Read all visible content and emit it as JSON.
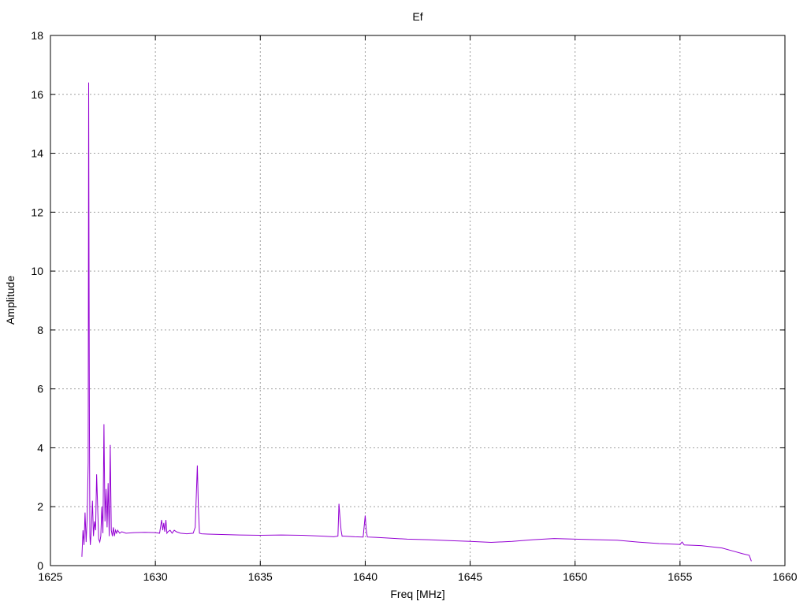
{
  "chart_data": {
    "type": "line",
    "title": "Ef",
    "xlabel": "Freq [MHz]",
    "ylabel": "Amplitude",
    "xlim": [
      1625,
      1660
    ],
    "ylim": [
      0,
      18
    ],
    "xticks": [
      1625,
      1630,
      1635,
      1640,
      1645,
      1650,
      1655,
      1660
    ],
    "yticks": [
      0,
      2,
      4,
      6,
      8,
      10,
      12,
      14,
      16,
      18
    ],
    "grid": true,
    "legend": "none",
    "series": [
      {
        "color": "#9400d3",
        "x": [
          1626.5,
          1626.55,
          1626.6,
          1626.65,
          1626.7,
          1626.75,
          1626.8,
          1626.82,
          1626.84,
          1626.86,
          1626.88,
          1626.9,
          1626.95,
          1627.0,
          1627.05,
          1627.1,
          1627.15,
          1627.2,
          1627.3,
          1627.35,
          1627.4,
          1627.45,
          1627.5,
          1627.55,
          1627.6,
          1627.65,
          1627.7,
          1627.75,
          1627.8,
          1627.85,
          1627.9,
          1627.95,
          1628.0,
          1628.05,
          1628.1,
          1628.15,
          1628.2,
          1628.3,
          1628.4,
          1628.6,
          1629.0,
          1629.5,
          1630.0,
          1630.2,
          1630.3,
          1630.35,
          1630.4,
          1630.45,
          1630.5,
          1630.55,
          1630.6,
          1630.7,
          1630.8,
          1630.9,
          1631.0,
          1631.2,
          1631.5,
          1631.8,
          1631.9,
          1632.0,
          1632.05,
          1632.1,
          1632.2,
          1632.5,
          1633.0,
          1634.0,
          1635.0,
          1636.0,
          1637.0,
          1638.0,
          1638.5,
          1638.7,
          1638.75,
          1638.8,
          1638.85,
          1638.9,
          1639.0,
          1639.5,
          1639.9,
          1640.0,
          1640.05,
          1640.1,
          1640.5,
          1641.0,
          1642.0,
          1643.0,
          1644.0,
          1645.0,
          1646.0,
          1647.0,
          1648.0,
          1649.0,
          1650.0,
          1651.0,
          1652.0,
          1653.0,
          1654.0,
          1655.0,
          1655.1,
          1655.2,
          1656.0,
          1657.0,
          1657.5,
          1658.0,
          1658.3,
          1658.4
        ],
        "y": [
          0.3,
          1.2,
          0.7,
          1.8,
          0.8,
          1.6,
          3.5,
          16.4,
          9.9,
          4.5,
          1.0,
          0.7,
          1.2,
          2.2,
          1.0,
          1.5,
          1.2,
          3.1,
          0.9,
          0.8,
          1.0,
          2.0,
          1.1,
          4.8,
          1.5,
          2.6,
          1.3,
          2.8,
          1.0,
          4.1,
          1.2,
          1.0,
          1.3,
          1.0,
          1.2,
          1.1,
          1.2,
          1.1,
          1.15,
          1.1,
          1.12,
          1.13,
          1.12,
          1.1,
          1.55,
          1.2,
          1.45,
          1.15,
          1.55,
          1.1,
          1.15,
          1.2,
          1.1,
          1.2,
          1.15,
          1.1,
          1.08,
          1.1,
          1.3,
          3.4,
          2.0,
          1.1,
          1.08,
          1.07,
          1.06,
          1.04,
          1.03,
          1.04,
          1.03,
          1.0,
          0.98,
          1.0,
          2.1,
          1.6,
          1.2,
          1.0,
          1.0,
          0.98,
          0.97,
          1.7,
          1.2,
          0.97,
          0.96,
          0.94,
          0.9,
          0.88,
          0.85,
          0.82,
          0.79,
          0.82,
          0.88,
          0.92,
          0.9,
          0.88,
          0.86,
          0.8,
          0.75,
          0.72,
          0.8,
          0.7,
          0.68,
          0.6,
          0.5,
          0.4,
          0.35,
          0.15
        ]
      }
    ]
  }
}
